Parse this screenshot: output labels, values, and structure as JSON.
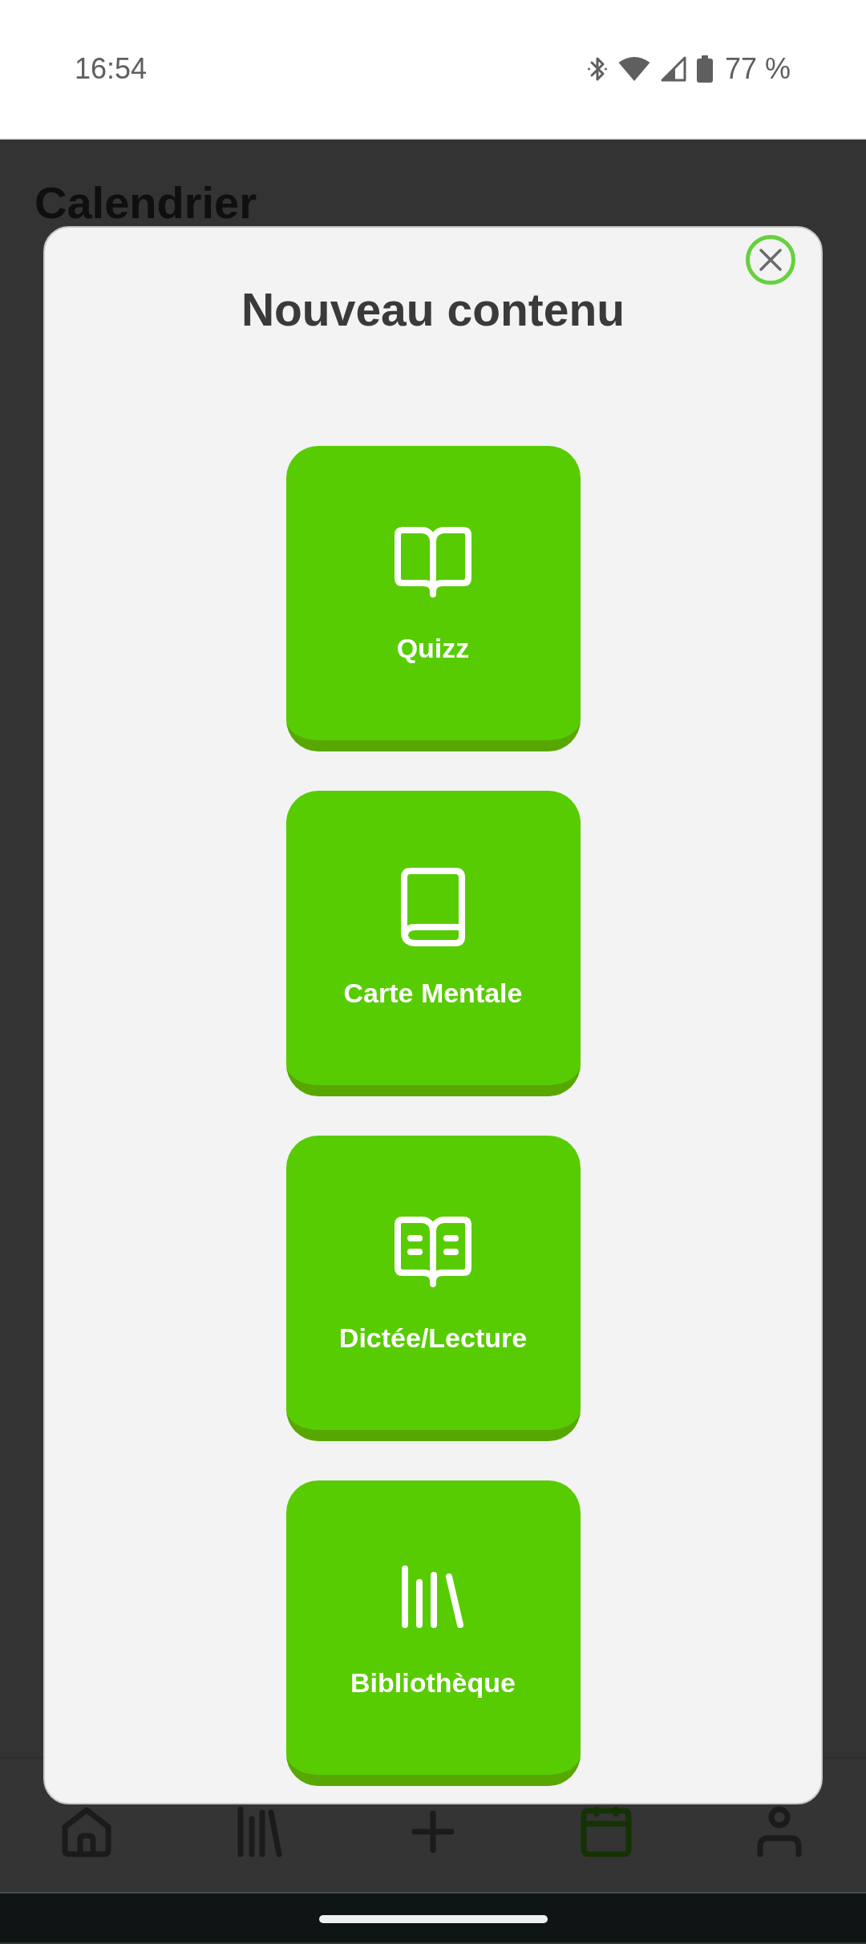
{
  "status_bar": {
    "time": "16:54",
    "battery": "77 %"
  },
  "page": {
    "title": "Calendrier"
  },
  "dialog": {
    "title": "Nouveau contenu",
    "options": [
      {
        "label": "Quizz",
        "kind": "open-book"
      },
      {
        "label": "Carte Mentale",
        "kind": "book"
      },
      {
        "label": "Dictée/Lecture",
        "kind": "reading"
      },
      {
        "label": "Bibliothèque",
        "kind": "library"
      }
    ]
  },
  "bottom_nav": [
    {
      "kind": "home",
      "selected": false
    },
    {
      "kind": "library",
      "selected": false
    },
    {
      "kind": "add",
      "selected": false
    },
    {
      "kind": "calendar",
      "selected": true
    },
    {
      "kind": "profile",
      "selected": false
    }
  ]
}
